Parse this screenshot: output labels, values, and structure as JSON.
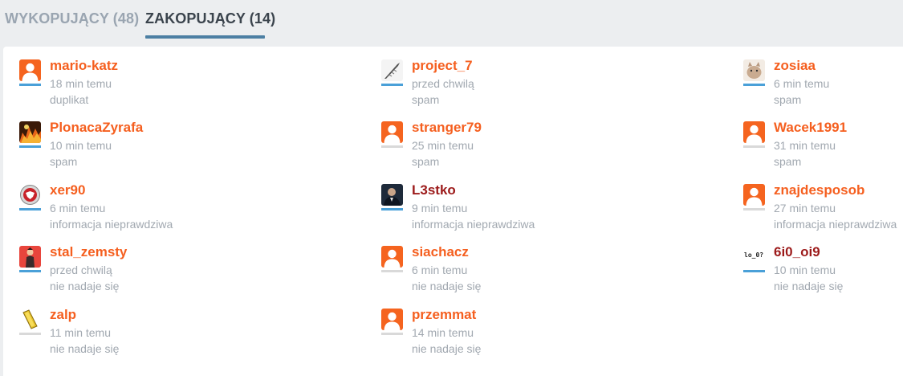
{
  "tabs": {
    "diggers_label": "WYKOPUJĄCY (48)",
    "buriers_label": "ZAKOPUJĄCY (14)"
  },
  "colors": {
    "name_orange": "#f55f1f",
    "name_darkred": "#9c1a1a",
    "gender_male": "#4aa0d8",
    "gender_none": "#d9d9d9",
    "active_tab_underline": "#4c7fa3"
  },
  "buriers": [
    {
      "user": "mario-katz",
      "time": "18 min temu",
      "reason": "duplikat",
      "avatar": "default-user-icon",
      "name_color": "orange",
      "gender": "male"
    },
    {
      "user": "PlonacaZyrafa",
      "time": "10 min temu",
      "reason": "spam",
      "avatar": "fiery-avatar",
      "name_color": "orange",
      "gender": "male"
    },
    {
      "user": "xer90",
      "time": "6 min temu",
      "reason": "informacja nieprawdziwa",
      "avatar": "eagle-emblem-avatar",
      "name_color": "orange",
      "gender": "male"
    },
    {
      "user": "stal_zemsty",
      "time": "przed chwilą",
      "reason": "nie nadaje się",
      "avatar": "character-avatar",
      "name_color": "orange",
      "gender": "male"
    },
    {
      "user": "zalp",
      "time": "11 min temu",
      "reason": "nie nadaje się",
      "avatar": "gold-bar-avatar",
      "name_color": "orange",
      "gender": "none"
    },
    {
      "user": "project_7",
      "time": "przed chwilą",
      "reason": "spam",
      "avatar": "quill-avatar",
      "name_color": "orange",
      "gender": "male"
    },
    {
      "user": "stranger79",
      "time": "25 min temu",
      "reason": "spam",
      "avatar": "default-user-icon",
      "name_color": "orange",
      "gender": "none"
    },
    {
      "user": "L3stko",
      "time": "9 min temu",
      "reason": "informacja nieprawdziwa",
      "avatar": "portrait-avatar",
      "name_color": "darkred",
      "gender": "male"
    },
    {
      "user": "siachacz",
      "time": "6 min temu",
      "reason": "nie nadaje się",
      "avatar": "default-user-icon",
      "name_color": "orange",
      "gender": "none"
    },
    {
      "user": "przemmat",
      "time": "14 min temu",
      "reason": "nie nadaje się",
      "avatar": "default-user-icon",
      "name_color": "orange",
      "gender": "none"
    },
    {
      "user": "zosiaa",
      "time": "6 min temu",
      "reason": "spam",
      "avatar": "cat-avatar",
      "name_color": "orange",
      "gender": "male"
    },
    {
      "user": "Wacek1991",
      "time": "31 min temu",
      "reason": "spam",
      "avatar": "default-user-icon",
      "name_color": "orange",
      "gender": "none"
    },
    {
      "user": "znajdesposob",
      "time": "27 min temu",
      "reason": "informacja nieprawdziwa",
      "avatar": "default-user-icon",
      "name_color": "orange",
      "gender": "none"
    },
    {
      "user": "6i0_oi9",
      "time": "10 min temu",
      "reason": "nie nadaje się",
      "avatar": "text-logo-avatar",
      "avatar_text": "lo_0?",
      "name_color": "darkred",
      "gender": "male"
    }
  ]
}
